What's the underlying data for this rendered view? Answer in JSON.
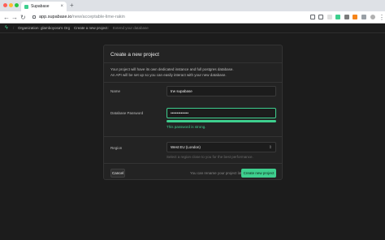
{
  "browser": {
    "tab_title": "Supabase",
    "url_host": "app.supabase.io",
    "url_path": "/new/acceptable-lime-rakin"
  },
  "nav": {
    "organization": "Organization: glamboyosa's Org",
    "create_project": "Create a new project",
    "extend_database": "Extend your database"
  },
  "card": {
    "title": "Create a new project",
    "description_line1": "Your project will have its own dedicated instance and full postgres database.",
    "description_line2": "An API will be set up so you can easily interact with your new database."
  },
  "fields": {
    "name_label": "Name",
    "name_value": "trw supabase",
    "password_label": "Database Password",
    "password_value": "••••••••••••••",
    "password_strength_percent": 100,
    "password_strength_text": "This password is strong.",
    "region_label": "Region",
    "region_value": "West EU (London)",
    "region_help": "Select a region close to you for the best performance."
  },
  "footer": {
    "cancel_label": "Cancel",
    "note": "You can rename your project later",
    "create_label": "Create new project"
  },
  "colors": {
    "accent": "#3ecf8e",
    "background": "#1c1c1c",
    "card": "#232323"
  }
}
